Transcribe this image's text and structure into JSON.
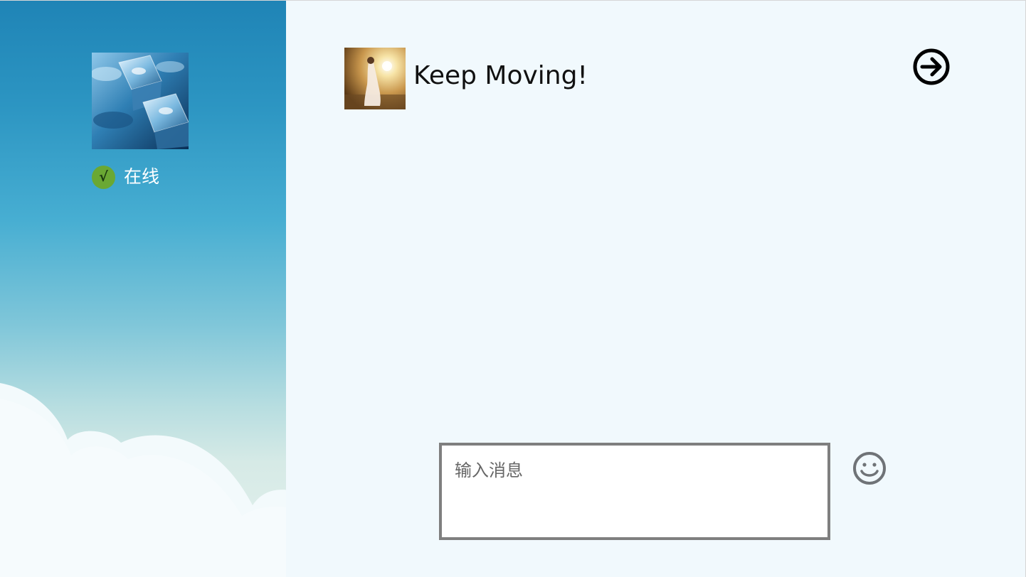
{
  "sidebar": {
    "user_avatar": {
      "alt": "ice cubes",
      "icon": "ice-cubes-photo"
    },
    "status": {
      "icon": "checkmark-icon",
      "mark": "√",
      "label": "在线",
      "color": "#6aa833"
    }
  },
  "chat": {
    "contact_avatar": {
      "icon": "woman-in-light-photo"
    },
    "contact_name": "Keep Moving!",
    "forward_icon": "arrow-right-circle-icon"
  },
  "composer": {
    "placeholder": "输入消息",
    "value": "",
    "emoji_icon": "smiley-icon"
  },
  "colors": {
    "sidebar_top": "#1f84b6",
    "sidebar_bottom": "#e6f2ef",
    "main_background": "#f1f9fd",
    "input_border": "#7f7f7f",
    "icon_gray": "#6f7377"
  }
}
